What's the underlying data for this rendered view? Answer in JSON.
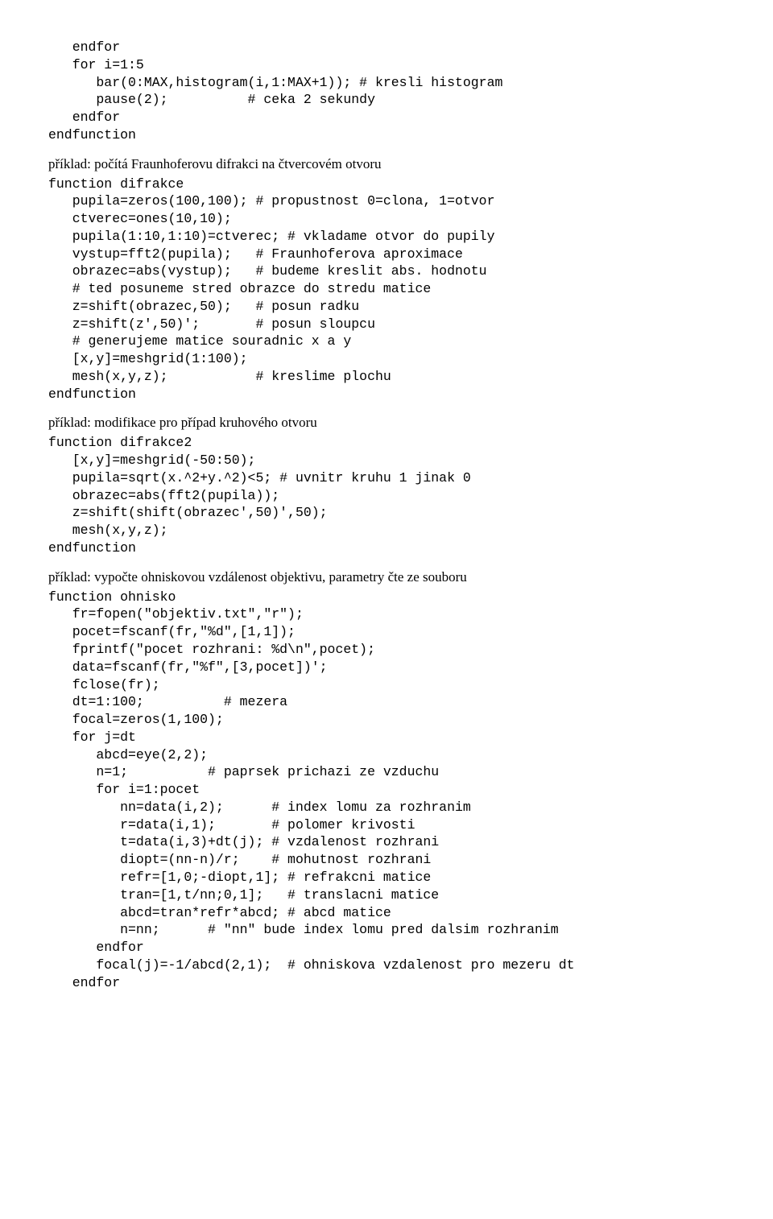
{
  "code0": "   endfor\n   for i=1:5\n      bar(0:MAX,histogram(i,1:MAX+1)); # kresli histogram\n      pause(2);          # ceka 2 sekundy\n   endfor\nendfunction",
  "narr1": "příklad: počítá Fraunhoferovu difrakci na čtvercovém otvoru",
  "code1": "function difrakce\n   pupila=zeros(100,100); # propustnost 0=clona, 1=otvor\n   ctverec=ones(10,10);\n   pupila(1:10,1:10)=ctverec; # vkladame otvor do pupily\n   vystup=fft2(pupila);   # Fraunhoferova aproximace\n   obrazec=abs(vystup);   # budeme kreslit abs. hodnotu\n   # ted posuneme stred obrazce do stredu matice\n   z=shift(obrazec,50);   # posun radku\n   z=shift(z',50)';       # posun sloupcu\n   # generujeme matice souradnic x a y\n   [x,y]=meshgrid(1:100);\n   mesh(x,y,z);           # kreslime plochu\nendfunction",
  "narr2": "příklad: modifikace pro případ kruhového otvoru",
  "code2": "function difrakce2\n   [x,y]=meshgrid(-50:50);\n   pupila=sqrt(x.^2+y.^2)<5; # uvnitr kruhu 1 jinak 0\n   obrazec=abs(fft2(pupila));\n   z=shift(shift(obrazec',50)',50);\n   mesh(x,y,z);\nendfunction",
  "narr3": "příklad: vypočte ohniskovou vzdálenost objektivu, parametry čte ze souboru",
  "code3": "function ohnisko\n   fr=fopen(\"objektiv.txt\",\"r\");\n   pocet=fscanf(fr,\"%d\",[1,1]);\n   fprintf(\"pocet rozhrani: %d\\n\",pocet);\n   data=fscanf(fr,\"%f\",[3,pocet])';\n   fclose(fr);\n   dt=1:100;          # mezera\n   focal=zeros(1,100);\n   for j=dt\n      abcd=eye(2,2);\n      n=1;          # paprsek prichazi ze vzduchu\n      for i=1:pocet\n         nn=data(i,2);      # index lomu za rozhranim\n         r=data(i,1);       # polomer krivosti\n         t=data(i,3)+dt(j); # vzdalenost rozhrani\n         diopt=(nn-n)/r;    # mohutnost rozhrani\n         refr=[1,0;-diopt,1]; # refrakcni matice\n         tran=[1,t/nn;0,1];   # translacni matice\n         abcd=tran*refr*abcd; # abcd matice\n         n=nn;      # \"nn\" bude index lomu pred dalsim rozhranim\n      endfor\n      focal(j)=-1/abcd(2,1);  # ohniskova vzdalenost pro mezeru dt\n   endfor"
}
